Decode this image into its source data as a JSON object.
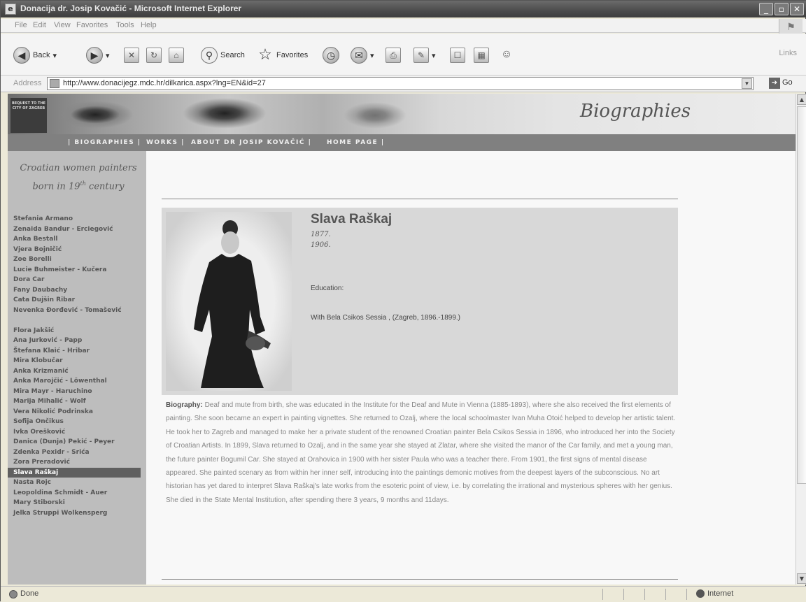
{
  "window": {
    "title": "Donacija dr. Josip Kovačić - Microsoft Internet Explorer",
    "minimize": "_",
    "maximize": "▫",
    "close": "✕"
  },
  "menu": [
    "File",
    "Edit",
    "View",
    "Favorites",
    "Tools",
    "Help"
  ],
  "toolbar": {
    "back": "Back",
    "search": "Search",
    "favorites": "Favorites",
    "links": "Links"
  },
  "address": {
    "label": "Address",
    "url": "http://www.donacijegz.mdc.hr/dilkarica.aspx?lng=EN&id=27",
    "go": "Go"
  },
  "site": {
    "badge": "BEQUEST TO THE CITY OF ZAGREB",
    "banner_title": "Biographies",
    "nav": [
      "| BIOGRAPHIES |",
      "WORKS |",
      "ABOUT DR JOSIP KOVAČIĆ |",
      "HOME PAGE |"
    ]
  },
  "sidebar": {
    "title_line1": "Croatian women painters",
    "title_line2": "born in 19",
    "title_sup": "th",
    "title_line2_end": " century",
    "items": [
      "Stefania Armano",
      "Zenaida Bandur - Erciegović",
      "Anka Bestall",
      "Vjera Bojničić",
      "Zoe Borelli",
      "Lucie Buhmeister - Kučera",
      "Dora Car",
      "Fany Daubachy",
      "Cata Dujšin Ribar",
      "Nevenka Đorđević - Tomašević",
      "Flora Jakšić",
      "Ana Jurković - Papp",
      "Štefana Klaić - Hribar",
      "Mira Klobučar",
      "Anka Krizmanić",
      "Anka Marojčić - Löwenthal",
      "Mira Mayr - Haruchino",
      "Marija Mihalić - Wolf",
      "Vera Nikolić Podrinska",
      "Sofija Ončikus",
      "Ivka Orešković",
      "Danica (Dunja) Pekić - Peyer",
      "Zdenka Pexidr - Srića",
      "Zora Preradović",
      "Slava Raškaj",
      "Nasta Rojc",
      "Leopoldina Schmidt - Auer",
      "Mary Stiborski",
      "Jelka Struppi Wolkensperg"
    ],
    "active_index": 24
  },
  "profile": {
    "name": "Slava Raškaj",
    "birth": "1877.",
    "death": "1906.",
    "education_label": "Education:",
    "education": "With Bela Csikos Sessia , (Zagreb, 1896.-1899.)"
  },
  "biography": {
    "label": "Biography:",
    "text": "Deaf and mute from birth, she was educated in the Institute for the Deaf and Mute in Vienna (1885-1893), where she also received the first elements of painting. She soon became an expert in painting vignettes. She returned to Ozalj, where the local schoolmaster Ivan Muha Otoić helped to develop her artistic talent. He took her to Zagreb and managed to make her a private student of the renowned Croatian painter Bela Csikos Sessia in 1896, who introduced her into the Society of Croatian Artists. In 1899, Slava returned to Ozalj, and in the same year she stayed at Zlatar, where she visited the manor of the Car family, and met a young man, the future painter Bogumil Car. She stayed at Orahovica in 1900 with her sister Paula who was a teacher there. From 1901, the first signs of mental disease appeared. She painted scenary as from within her inner self, introducing into the paintings demonic motives from the deepest layers of the subconscious. No art historian has yet dared to interpret Slava Raškaj's late works from the esoteric point of view, i.e. by correlating the irrational and mysterious spheres with her genius. She died in the State Mental Institution, after spending there 3 years, 9 months and 11days."
  },
  "status": {
    "text": "Done",
    "zone": "Internet"
  }
}
